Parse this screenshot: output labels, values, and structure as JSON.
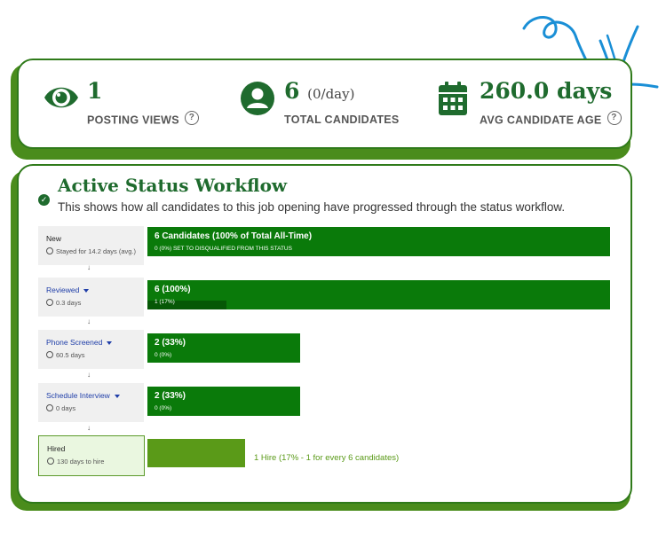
{
  "stats": {
    "views": {
      "value": "1",
      "label": "POSTING VIEWS",
      "icon": "eye-icon"
    },
    "candidates": {
      "value": "6",
      "suffix": "(0/day)",
      "label": "TOTAL CANDIDATES",
      "icon": "user-icon"
    },
    "age": {
      "value": "260.0 days",
      "label": "AVG CANDIDATE AGE",
      "icon": "calendar-icon"
    }
  },
  "help_glyph": "?",
  "workflow": {
    "title": "Active Status Workflow",
    "subtitle": "This shows how all candidates to this job opening have progressed through the status workflow.",
    "arrow_glyph": "↓",
    "stages": [
      {
        "name": "New",
        "time": "Stayed for 14.2 days (avg.)",
        "bar_label": "6 Candidates (100% of Total All-Time)",
        "bar_sub": "0 (0%) SET TO DISQUALIFIED FROM THIS STATUS",
        "fraction": 1.0,
        "sub_fraction": 0.0
      },
      {
        "name": "Reviewed",
        "time": "0.3 days",
        "bar_label": "6 (100%)",
        "bar_sub": "1 (17%)",
        "fraction": 1.0,
        "sub_fraction": 0.17
      },
      {
        "name": "Phone Screened",
        "time": "60.5 days",
        "bar_label": "2 (33%)",
        "bar_sub": "0 (0%)",
        "fraction": 0.33,
        "sub_fraction": 0.0
      },
      {
        "name": "Schedule Interview",
        "time": "0 days",
        "bar_label": "2 (33%)",
        "bar_sub": "0 (0%)",
        "fraction": 0.33,
        "sub_fraction": 0.0
      }
    ],
    "hired": {
      "name": "Hired",
      "time": "130 days to hire",
      "note": "1 Hire (17% - 1 for every 6 candidates)",
      "fraction": 0.17
    }
  },
  "colors": {
    "brand_green": "#1f6b2e",
    "bar_green": "#0a7a0a",
    "hired_green": "#5a9a18",
    "link_blue": "#1f3ea8",
    "doodle_blue": "#1a8fd6"
  }
}
